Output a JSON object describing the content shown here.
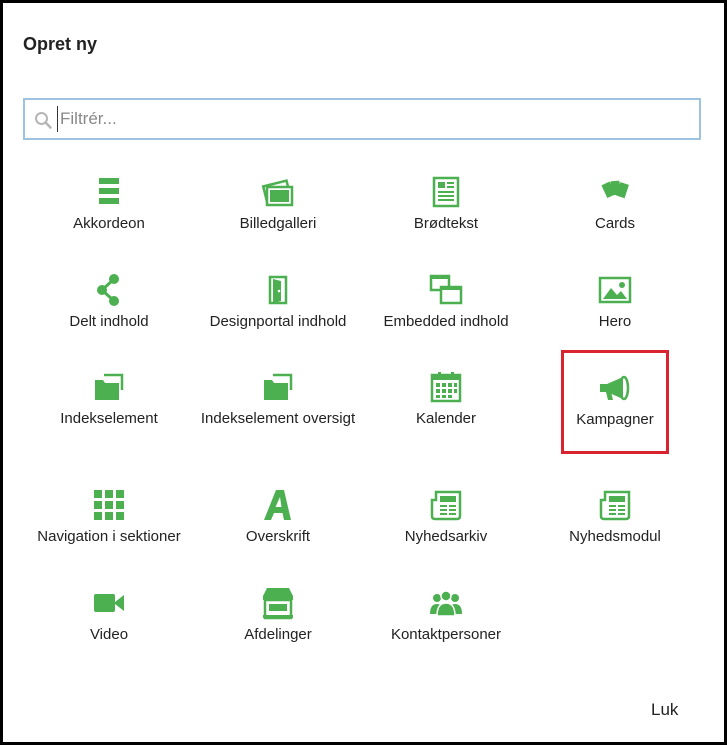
{
  "dialog": {
    "title": "Opret ny",
    "search": {
      "placeholder": "Filtrér...",
      "value": ""
    },
    "close_label": "Luk",
    "accent_color": "#4caf50",
    "highlight_color": "#d9232f",
    "items": [
      {
        "id": "akkordeon",
        "label": "Akkordeon",
        "icon": "list-lines-icon"
      },
      {
        "id": "billedgalleri",
        "label": "Billedgalleri",
        "icon": "photo-stack-icon"
      },
      {
        "id": "broedtekst",
        "label": "Brødtekst",
        "icon": "article-icon"
      },
      {
        "id": "cards",
        "label": "Cards",
        "icon": "cards-icon"
      },
      {
        "id": "delt-indhold",
        "label": "Delt indhold",
        "icon": "share-icon"
      },
      {
        "id": "designportal-indhold",
        "label": "Designportal indhold",
        "icon": "door-icon"
      },
      {
        "id": "embedded-indhold",
        "label": "Embedded indhold",
        "icon": "windows-icon"
      },
      {
        "id": "hero",
        "label": "Hero",
        "icon": "image-icon"
      },
      {
        "id": "indekselement",
        "label": "Indekselement",
        "icon": "folder-icon"
      },
      {
        "id": "indekselement-oversigt",
        "label": "Indekselement oversigt",
        "icon": "folder-icon"
      },
      {
        "id": "kalender",
        "label": "Kalender",
        "icon": "calendar-icon"
      },
      {
        "id": "kampagner",
        "label": "Kampagner",
        "icon": "megaphone-icon"
      },
      {
        "id": "navigation-i-sektioner",
        "label": "Navigation i sektioner",
        "icon": "grid-icon"
      },
      {
        "id": "overskrift",
        "label": "Overskrift",
        "icon": "letter-a-icon"
      },
      {
        "id": "nyhedsarkiv",
        "label": "Nyhedsarkiv",
        "icon": "newspaper-icon"
      },
      {
        "id": "nyhedsmodul",
        "label": "Nyhedsmodul",
        "icon": "newspaper-icon"
      },
      {
        "id": "video",
        "label": "Video",
        "icon": "video-camera-icon"
      },
      {
        "id": "afdelinger",
        "label": "Afdelinger",
        "icon": "storefront-icon"
      },
      {
        "id": "kontaktpersoner",
        "label": "Kontaktpersoner",
        "icon": "people-group-icon"
      }
    ]
  }
}
